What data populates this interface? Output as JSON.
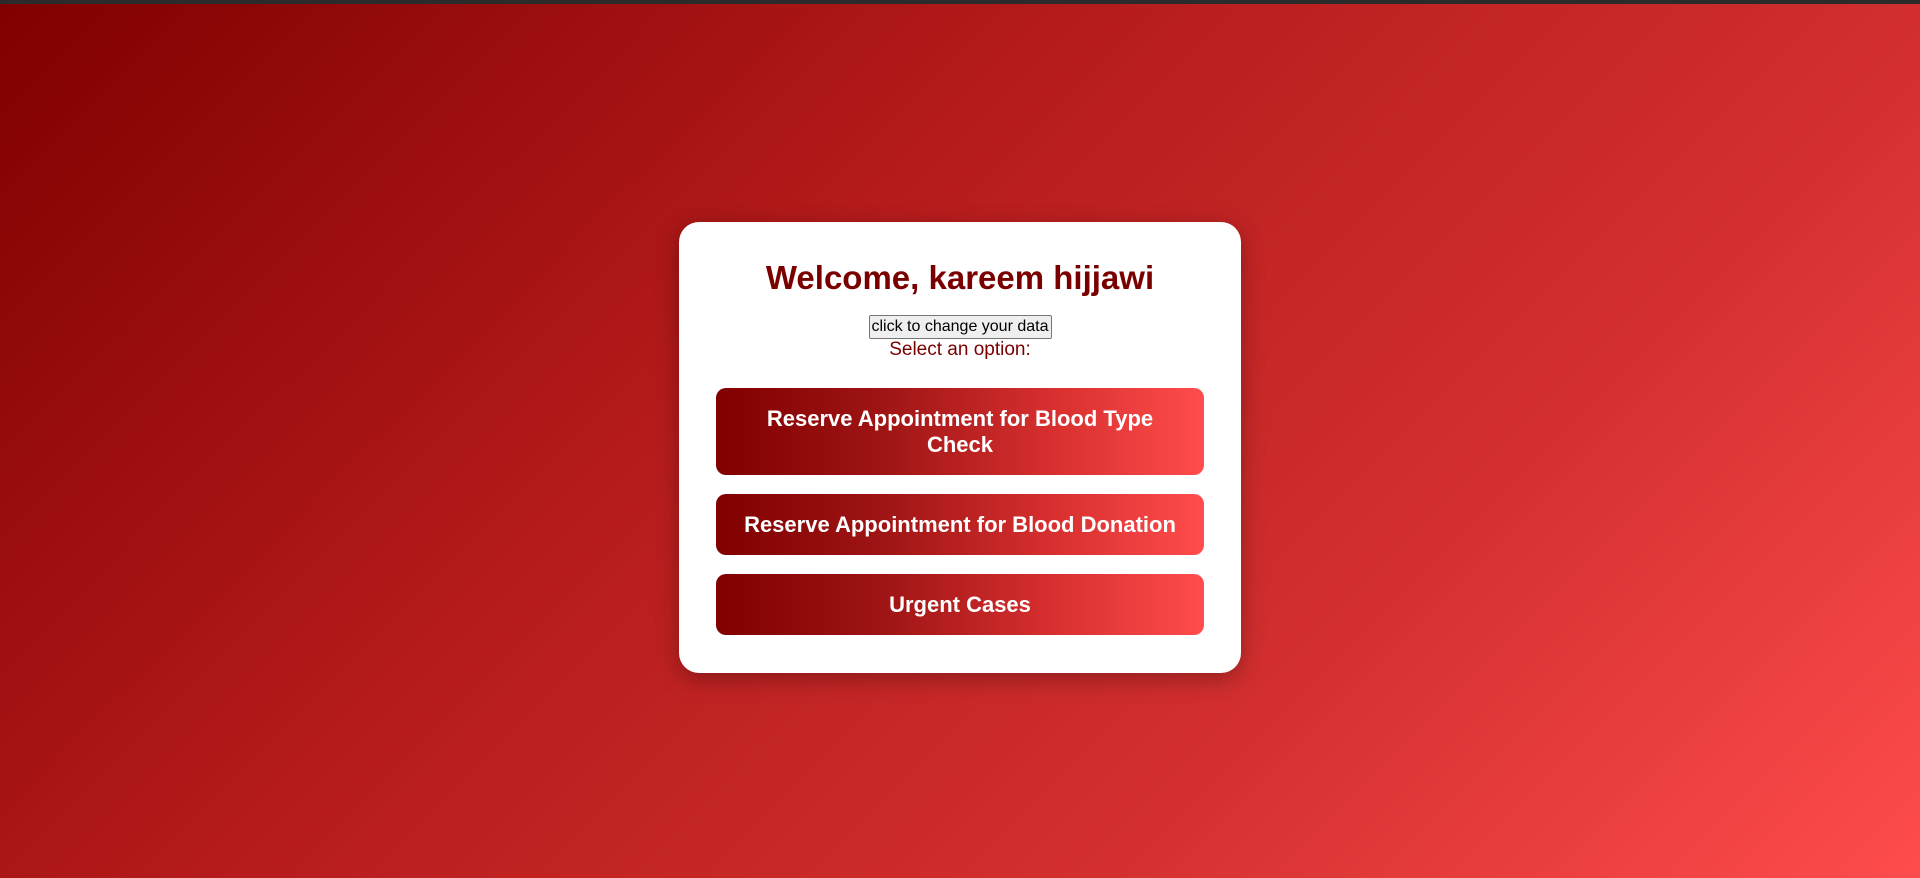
{
  "welcome": {
    "title": "Welcome, kareem hijjawi",
    "change_button": "click to change your data",
    "select_label": "Select an option:"
  },
  "options": [
    {
      "label": "Reserve Appointment for Blood Type Check"
    },
    {
      "label": "Reserve Appointment for Blood Donation"
    },
    {
      "label": "Urgent Cases"
    }
  ],
  "colors": {
    "primary_dark": "#800000",
    "primary_light": "#ff4c4c",
    "card_background": "#ffffff",
    "title_color": "#7a0000"
  }
}
